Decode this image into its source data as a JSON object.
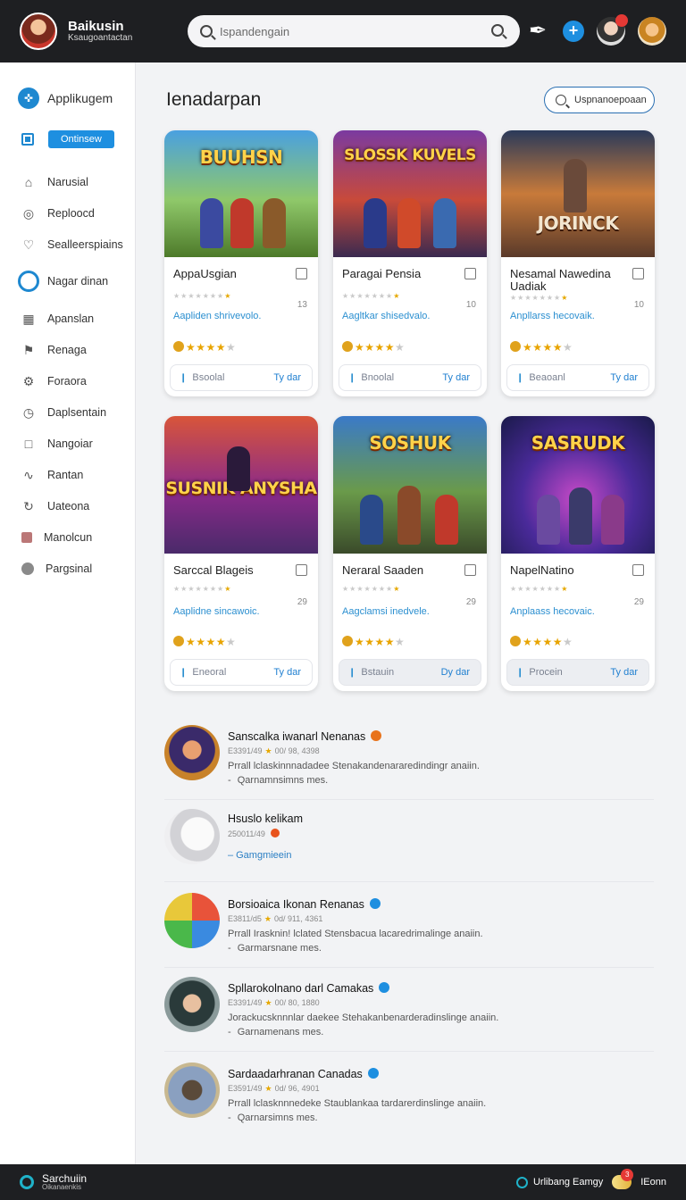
{
  "header": {
    "brand_title": "Baikusin",
    "brand_subtitle": "Ksaugoantactan",
    "search_placeholder": "Ispandengain"
  },
  "sidebar": {
    "head_label": "Applikugem",
    "pill_label": "Ontinsew",
    "items": [
      {
        "label": "Narusial",
        "icon": "home-icon"
      },
      {
        "label": "Reploocd",
        "icon": "target-icon"
      },
      {
        "label": "Sealleerspiains",
        "icon": "heart-icon"
      },
      {
        "label": "Nagar dinan",
        "icon": "ring-icon"
      },
      {
        "label": "Apanslan",
        "icon": "grid-icon"
      },
      {
        "label": "Renaga",
        "icon": "flag-icon"
      },
      {
        "label": "Foraora",
        "icon": "gear-icon"
      },
      {
        "label": "Daplsentain",
        "icon": "clock-icon"
      },
      {
        "label": "Nangoiar",
        "icon": "square-icon"
      },
      {
        "label": "Rantan",
        "icon": "graph-icon"
      },
      {
        "label": "Uateona",
        "icon": "refresh-icon"
      },
      {
        "label": "Manolcun",
        "icon": "box-icon"
      },
      {
        "label": "Pargsinal",
        "icon": "dot-icon"
      }
    ]
  },
  "main": {
    "title": "Ienadarpan",
    "search_pill": "Uspnanoepoaan"
  },
  "cards": [
    {
      "name": "AppaUsgian",
      "art_title": "BUUHSN",
      "desc": "Aapliden shrivevolo.",
      "num": "13",
      "secondary": "Bsoolal",
      "primary": "Ty dar"
    },
    {
      "name": "Paragai Pensia",
      "art_title": "SLOSSK KUVELS",
      "desc": "Aagltkar shisedvalo.",
      "num": "10",
      "secondary": "Bnoolal",
      "primary": "Ty dar"
    },
    {
      "name": "Nesamal Nawedina Uadiak",
      "art_title": "JORINCK",
      "desc": "Anpllarss hecovaik.",
      "num": "10",
      "secondary": "Beaoanl",
      "primary": "Ty dar"
    },
    {
      "name": "Sarccal Blageis",
      "art_title": "SUSNIK ANYSHA",
      "desc": "Aaplidne sincawoic.",
      "num": "29",
      "secondary": "Eneoral",
      "primary": "Ty dar"
    },
    {
      "name": "Neraral Saaden",
      "art_title": "SOSHUK",
      "desc": "Aagclamsi inedvele.",
      "num": "29",
      "secondary": "Bstauin",
      "primary": "Dy dar"
    },
    {
      "name": "NapelNatino",
      "art_title": "SASRUDK",
      "desc": "Anplaass hecovaic.",
      "num": "29",
      "secondary": "Procein",
      "primary": "Ty dar"
    }
  ],
  "list": [
    {
      "title": "Sanscalka iwanarl Nenanas",
      "badge_color": "#e8731c",
      "meta": "E3391/49",
      "meta2": "00/ 98, 4398",
      "desc": "Prrall lclaskinnnadadee Stenakandenararedindingr anaiin.",
      "sub": "Qarnamnsimns mes."
    },
    {
      "title": "Hsuslo kelikam",
      "badge_color": "#e8531c",
      "meta": "250011/49",
      "link": "Gamgmieein"
    },
    {
      "title": "Borsioaica Ikonan Renanas",
      "badge_color": "#1e8fe0",
      "meta": "E3811/d5",
      "meta2": "0d/ 911, 4361",
      "desc": "Prrall Irasknin! lclated Stensbacua lacaredrimalinge anaiin.",
      "sub": "Garmarsnane mes."
    },
    {
      "title": "Spllarokolnano darl Camakas",
      "badge_color": "#1e8fe0",
      "meta": "E3391/49",
      "meta2": "00/ 80, 1880",
      "desc": "Jorackucsknnnlar daekee Stehakanbenarderadinslinge anaiin.",
      "sub": "Garnamenans mes."
    },
    {
      "title": "Sardaadarhranan Canadas",
      "badge_color": "#1e8fe0",
      "meta": "E3591/49",
      "meta2": "0d/ 96, 4901",
      "desc": "Prrall lclasknnnedeke Staublankaa tardarerdinslinge anaiin.",
      "sub": "Qarnarsimns mes."
    }
  ],
  "footer": {
    "brand_title": "Sarchuiin",
    "brand_subtitle": "Oikanaenkis",
    "status_label": "Urlibang Eamgy",
    "coin_badge": "3",
    "account_label": "IEonn"
  },
  "colors": {
    "accent": "#1e8fe0",
    "topbar": "#1e1f22",
    "link": "#2b8fd0"
  }
}
